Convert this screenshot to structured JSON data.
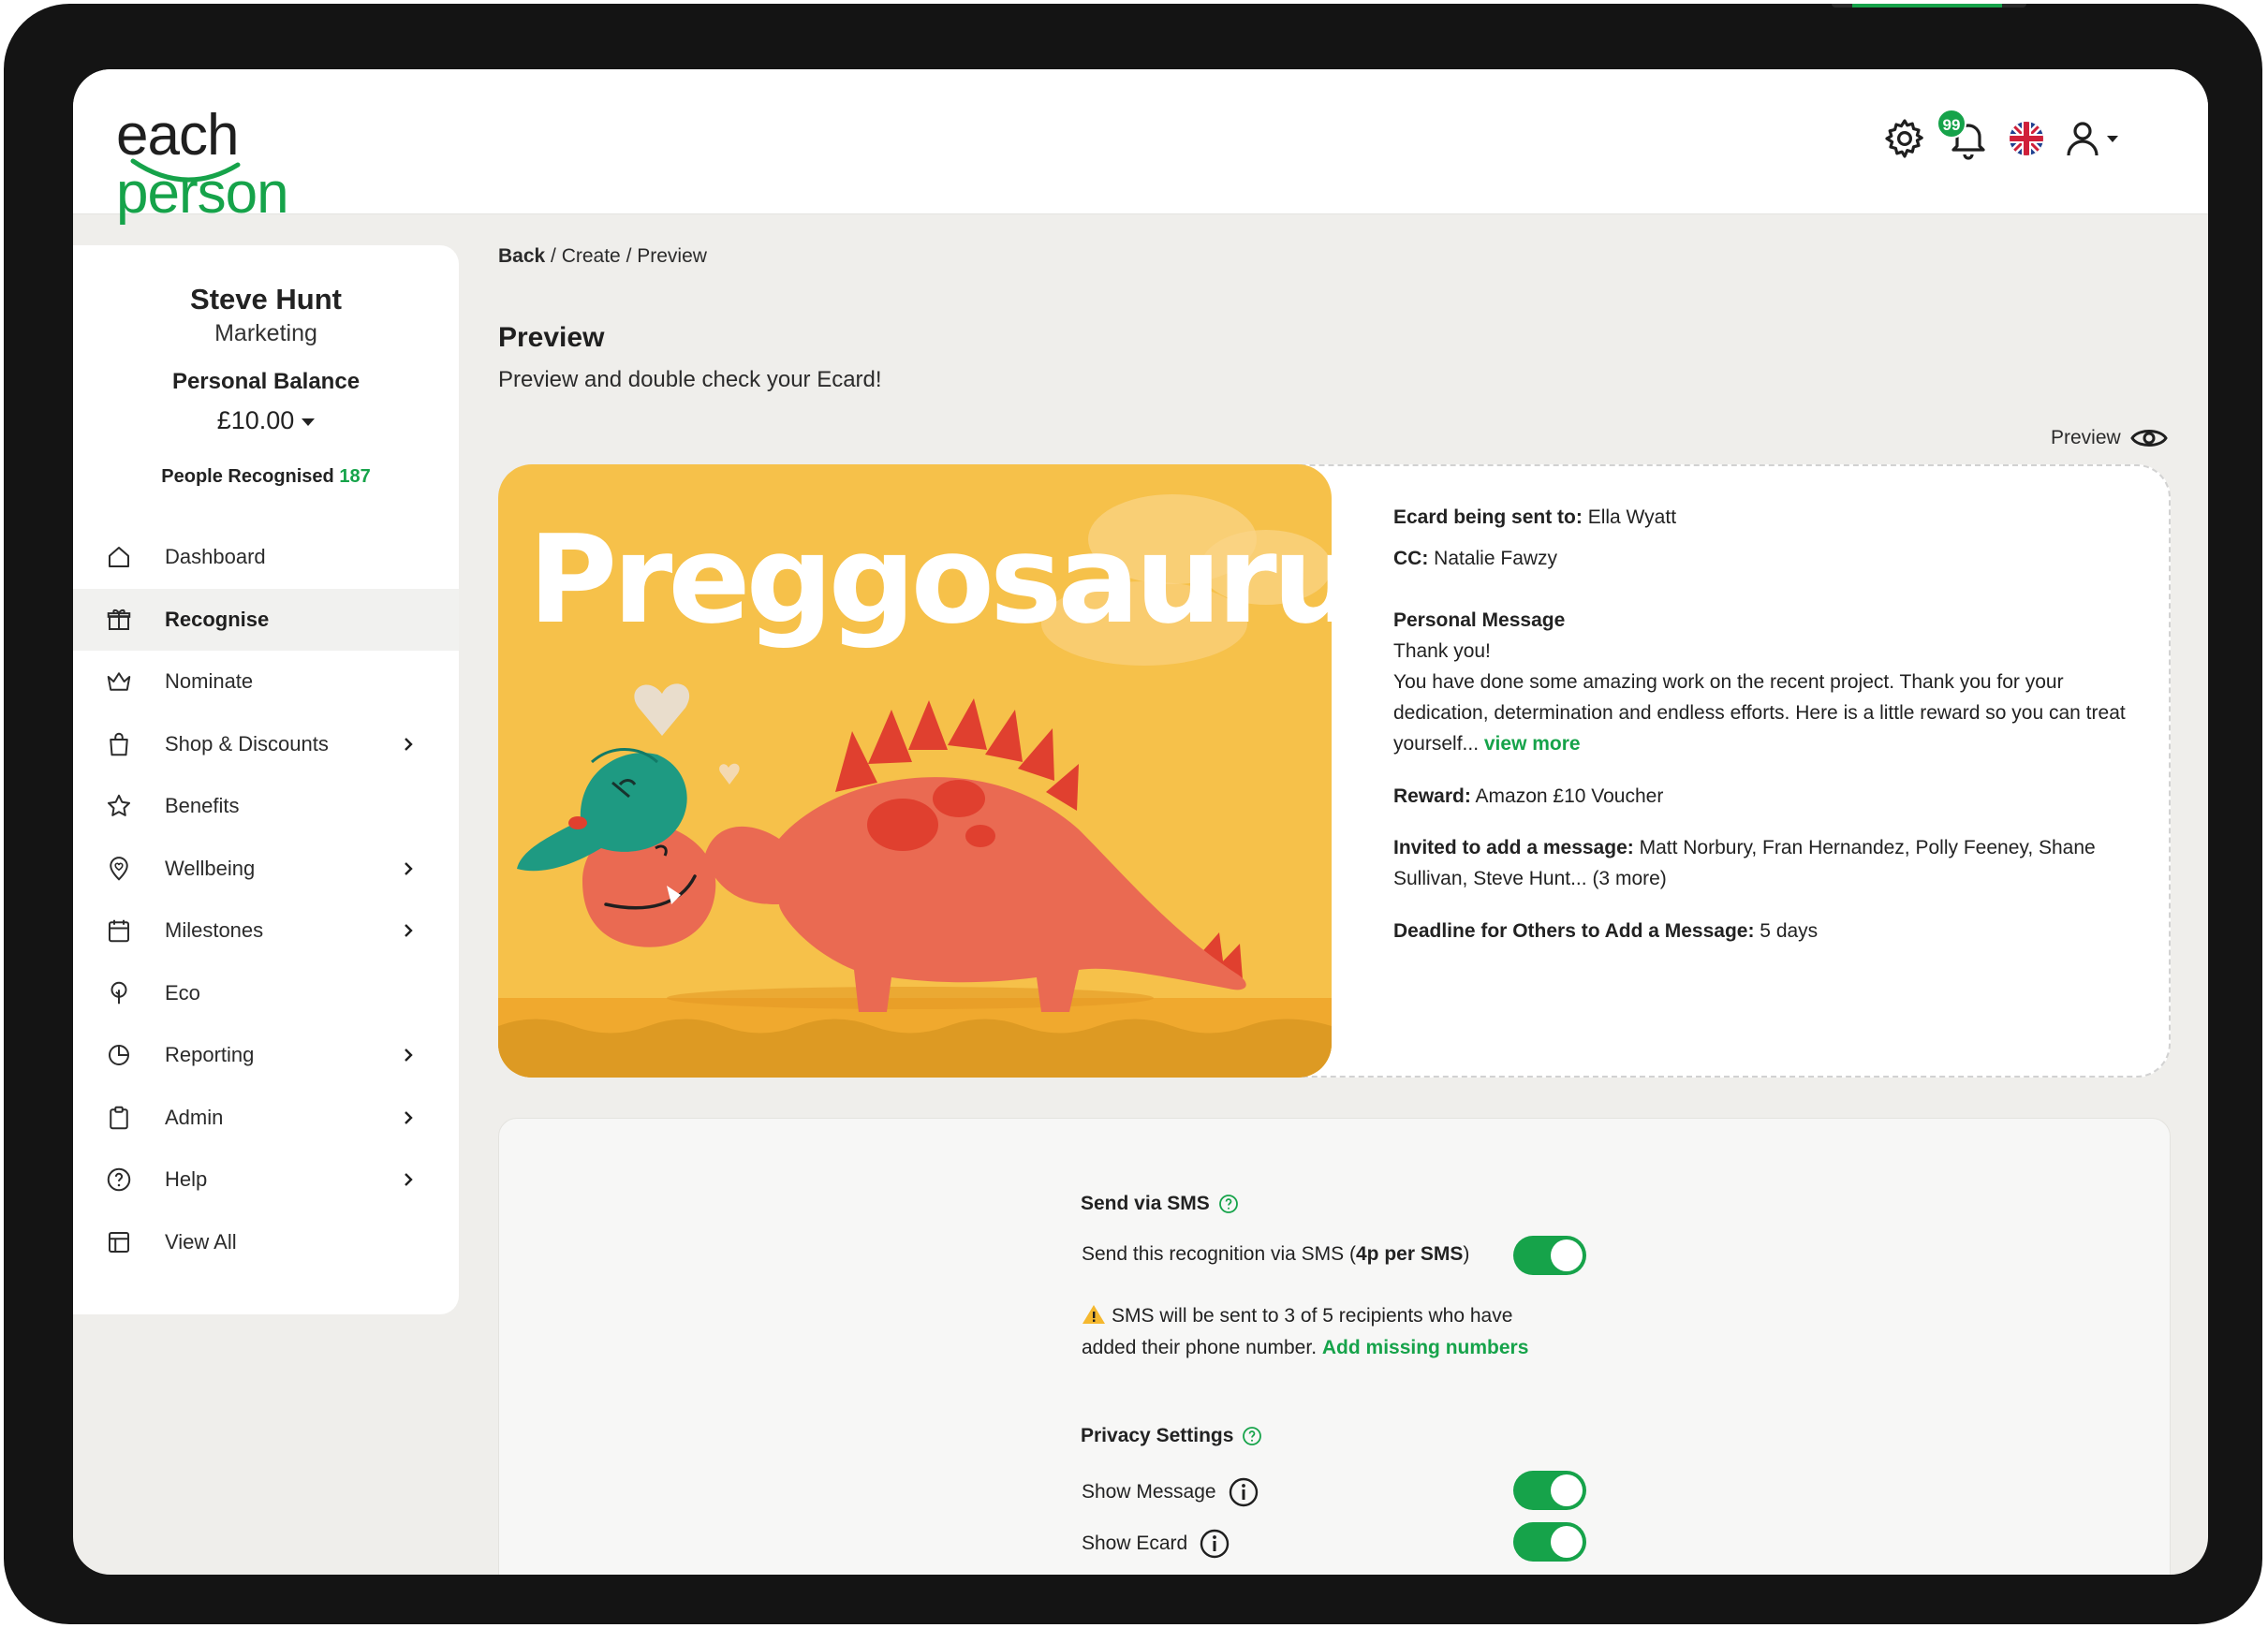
{
  "app": {
    "logo_word_1": "each ",
    "logo_word_2": "person",
    "notifications_count": "99",
    "colors": {
      "brand_green": "#16a34a",
      "card_yellow": "#f6c14a",
      "dino_red": "#ea6a52"
    }
  },
  "header": {
    "icons": [
      "gear-icon",
      "bell-icon",
      "uk-flag-icon",
      "user-icon",
      "chevron-down-icon"
    ]
  },
  "profile": {
    "name": "Steve Hunt",
    "department": "Marketing",
    "balance_label": "Personal Balance",
    "balance": "£10.00",
    "recognised_label": "People Recognised",
    "recognised_count": "187"
  },
  "nav": [
    {
      "label": "Dashboard",
      "icon": "home-icon",
      "chevron": false,
      "active": false
    },
    {
      "label": "Recognise",
      "icon": "gift-icon",
      "chevron": false,
      "active": true
    },
    {
      "label": "Nominate",
      "icon": "crown-icon",
      "chevron": false,
      "active": false
    },
    {
      "label": "Shop & Discounts",
      "icon": "bag-icon",
      "chevron": true,
      "active": false
    },
    {
      "label": "Benefits",
      "icon": "star-icon",
      "chevron": false,
      "active": false
    },
    {
      "label": "Wellbeing",
      "icon": "heart-pin-icon",
      "chevron": true,
      "active": false
    },
    {
      "label": "Milestones",
      "icon": "calendar-icon",
      "chevron": true,
      "active": false
    },
    {
      "label": "Eco",
      "icon": "tree-icon",
      "chevron": false,
      "active": false
    },
    {
      "label": "Reporting",
      "icon": "pie-chart-icon",
      "chevron": true,
      "active": false
    },
    {
      "label": "Admin",
      "icon": "clipboard-icon",
      "chevron": true,
      "active": false
    },
    {
      "label": "Help",
      "icon": "help-circle-icon",
      "chevron": true,
      "active": false
    },
    {
      "label": "View All",
      "icon": "layout-icon",
      "chevron": false,
      "active": false
    }
  ],
  "breadcrumb": {
    "back": "Back",
    "rest": " / Create / Preview"
  },
  "page": {
    "title": "Preview",
    "subtitle": "Preview and double check your Ecard!",
    "preview_link": "Preview"
  },
  "ecard": {
    "title": "Preggosaurus"
  },
  "details": {
    "sent_to_label": "Ecard being sent to:",
    "sent_to": " Ella Wyatt",
    "cc_label": "CC:",
    "cc": " Natalie Fawzy",
    "message_label": "Personal Message",
    "message_line1": "Thank you!",
    "message_body": "You have done some amazing work on the recent project. Thank you for your dedication, determination and endless efforts. Here is a little reward so you can treat yourself... ",
    "view_more": "view more",
    "reward_label": "Reward:",
    "reward": " Amazon £10 Voucher",
    "invited_label": "Invited to add a message:",
    "invited": " Matt Norbury, Fran Hernandez, Polly Feeney, Shane Sullivan, Steve Hunt... (3 more)",
    "deadline_label": "Deadline for Others to Add a Message:",
    "deadline": " 5 days"
  },
  "sms": {
    "title": "Send via SMS",
    "toggle_text_pre": "Send this recognition via SMS (",
    "toggle_text_bold": "4p per SMS",
    "toggle_text_post": ")",
    "toggle_on": true,
    "warning_line1": "SMS will be sent to 3 of 5 recipients who have",
    "warning_line2": "added their phone number. ",
    "add_missing": "Add missing numbers"
  },
  "privacy": {
    "title": "Privacy Settings",
    "show_message": "Show Message",
    "show_message_on": true,
    "show_ecard": "Show Ecard",
    "show_ecard_on": true
  }
}
